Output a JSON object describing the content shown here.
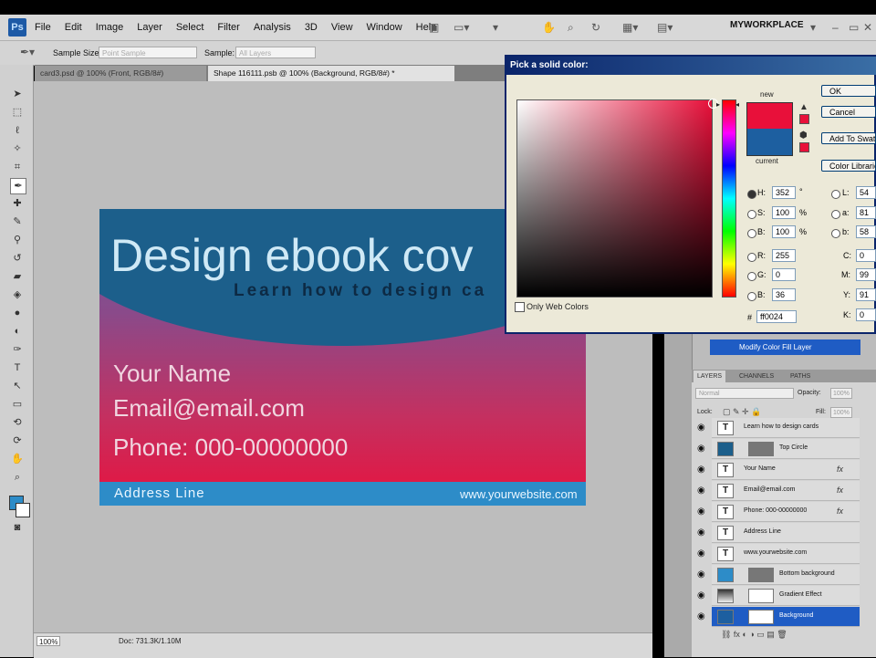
{
  "menu": {
    "items": [
      "File",
      "Edit",
      "Image",
      "Layer",
      "Select",
      "Filter",
      "Analysis",
      "3D",
      "View",
      "Window",
      "Help"
    ],
    "workspace": "MYWORKPLACE",
    "app_logo": "Ps"
  },
  "options": {
    "sample_size_label": "Sample Size:",
    "sample_size_value": "Point Sample",
    "sample_label": "Sample:",
    "sample_value": "All Layers"
  },
  "tabs": [
    "card3.psd @ 100% (Front, RGB/8#)",
    "Shape 116111.psb @ 100% (Background, RGB/8#) *"
  ],
  "card": {
    "title": "Design ebook cov",
    "subtitle": "Learn how to design ca",
    "name": "Your Name",
    "email": "Email@email.com",
    "phone": "Phone: 000-00000000",
    "address": "Address Line",
    "website": "www.yourwebsite.com"
  },
  "status": {
    "zoom": "100%",
    "doc": "Doc: 731.3K/1.10M"
  },
  "history": {
    "item": "Modify Color Fill Layer"
  },
  "layers": {
    "tabs": [
      "LAYERS",
      "CHANNELS",
      "PATHS"
    ],
    "blend": "Normal",
    "opacity_label": "Opacity:",
    "opacity": "100%",
    "lock_label": "Lock:",
    "fill_label": "Fill:",
    "fill": "100%",
    "rows": [
      {
        "name": "Learn how to design cards",
        "thumb": "T",
        "fx": ""
      },
      {
        "name": "Top Circle",
        "thumb": "",
        "fx": ""
      },
      {
        "name": "Your Name",
        "thumb": "T",
        "fx": "fx"
      },
      {
        "name": "Email@email.com",
        "thumb": "T",
        "fx": "fx"
      },
      {
        "name": "Phone: 000-00000000",
        "thumb": "T",
        "fx": "fx"
      },
      {
        "name": "Address Line",
        "thumb": "T",
        "fx": ""
      },
      {
        "name": "www.yourwebsite.com",
        "thumb": "T",
        "fx": ""
      },
      {
        "name": "Bottom background",
        "thumb": "",
        "fx": ""
      },
      {
        "name": "Gradient Effect",
        "thumb": "",
        "fx": ""
      },
      {
        "name": "Background",
        "thumb": "",
        "fx": ""
      }
    ]
  },
  "dialog": {
    "title": "Pick a solid color:",
    "ok": "OK",
    "cancel": "Cancel",
    "add_swatches": "Add To Swatches",
    "color_libraries": "Color Libraries",
    "new_label": "new",
    "current_label": "current",
    "only_web": "Only Web Colors",
    "H": "352",
    "S": "100",
    "B": "100",
    "R": "255",
    "G": "0",
    "Bl": "36",
    "L": "54",
    "a": "81",
    "b": "58",
    "C": "0",
    "M": "99",
    "Y": "91",
    "K": "0",
    "hex": "ff0024",
    "new_color": "#e8103a",
    "current_color": "#1d5fa0"
  }
}
